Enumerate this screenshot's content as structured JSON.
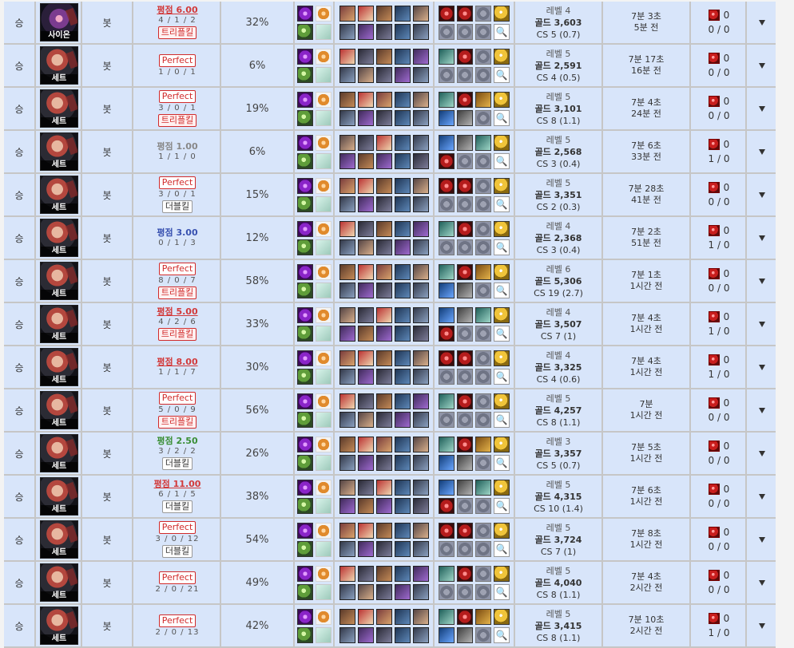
{
  "rows": [
    {
      "result": "승",
      "champion": "사이온",
      "portrait": "alt",
      "mode": "봇",
      "score_type": "score",
      "score_label": "평점 6.00",
      "score_color": "red",
      "kda": "4 / 1 / 2",
      "multikill": "트리플킬",
      "kp": "32%",
      "level": "레벨 4",
      "gold": "골드 3,603",
      "cs": "CS 5 (0.7)",
      "duration": "7분 3초",
      "ago": "5분 전",
      "ward_top": "0",
      "ward_bottom": "0 / 0"
    },
    {
      "result": "승",
      "champion": "세트",
      "portrait": "main",
      "mode": "봇",
      "score_type": "perfect",
      "score_label": "Perfect",
      "score_color": "red",
      "kda": "1 / 0 / 1",
      "multikill": "",
      "kp": "6%",
      "level": "레벨 5",
      "gold": "골드 2,591",
      "cs": "CS 4 (0.5)",
      "duration": "7분 17초",
      "ago": "16분 전",
      "ward_top": "0",
      "ward_bottom": "0 / 0"
    },
    {
      "result": "승",
      "champion": "세트",
      "portrait": "main",
      "mode": "봇",
      "score_type": "perfect",
      "score_label": "Perfect",
      "score_color": "red",
      "kda": "3 / 0 / 1",
      "multikill": "트리플킬",
      "kp": "19%",
      "level": "레벨 5",
      "gold": "골드 3,101",
      "cs": "CS 8 (1.1)",
      "duration": "7분 4초",
      "ago": "24분 전",
      "ward_top": "0",
      "ward_bottom": "0 / 0"
    },
    {
      "result": "승",
      "champion": "세트",
      "portrait": "main",
      "mode": "봇",
      "score_type": "score",
      "score_label": "평점 1.00",
      "score_color": "gray",
      "kda": "1 / 1 / 0",
      "multikill": "",
      "kp": "6%",
      "level": "레벨 5",
      "gold": "골드 2,568",
      "cs": "CS 3 (0.4)",
      "duration": "7분 6초",
      "ago": "33분 전",
      "ward_top": "0",
      "ward_bottom": "1 / 0"
    },
    {
      "result": "승",
      "champion": "세트",
      "portrait": "main",
      "mode": "봇",
      "score_type": "perfect",
      "score_label": "Perfect",
      "score_color": "red",
      "kda": "3 / 0 / 1",
      "multikill": "더블킬",
      "kp": "15%",
      "level": "레벨 5",
      "gold": "골드 3,351",
      "cs": "CS 2 (0.3)",
      "duration": "7분 28초",
      "ago": "41분 전",
      "ward_top": "0",
      "ward_bottom": "0 / 0"
    },
    {
      "result": "승",
      "champion": "세트",
      "portrait": "main",
      "mode": "봇",
      "score_type": "score",
      "score_label": "평점 3.00",
      "score_color": "blue",
      "kda": "0 / 1 / 3",
      "multikill": "",
      "kp": "12%",
      "level": "레벨 4",
      "gold": "골드 2,368",
      "cs": "CS 3 (0.4)",
      "duration": "7분 2초",
      "ago": "51분 전",
      "ward_top": "0",
      "ward_bottom": "1 / 0"
    },
    {
      "result": "승",
      "champion": "세트",
      "portrait": "main",
      "mode": "봇",
      "score_type": "perfect",
      "score_label": "Perfect",
      "score_color": "red",
      "kda": "8 / 0 / 7",
      "multikill": "트리플킬",
      "kp": "58%",
      "level": "레벨 6",
      "gold": "골드 5,306",
      "cs": "CS 19 (2.7)",
      "duration": "7분 1초",
      "ago": "1시간 전",
      "ward_top": "0",
      "ward_bottom": "0 / 0"
    },
    {
      "result": "승",
      "champion": "세트",
      "portrait": "main",
      "mode": "봇",
      "score_type": "score",
      "score_label": "평점 5.00",
      "score_color": "red",
      "kda": "4 / 2 / 6",
      "multikill": "트리플킬",
      "kp": "33%",
      "level": "레벨 4",
      "gold": "골드 3,507",
      "cs": "CS 7 (1)",
      "duration": "7분 4초",
      "ago": "1시간 전",
      "ward_top": "0",
      "ward_bottom": "1 / 0"
    },
    {
      "result": "승",
      "champion": "세트",
      "portrait": "main",
      "mode": "봇",
      "score_type": "score",
      "score_label": "평점 8.00",
      "score_color": "red",
      "kda": "1 / 1 / 7",
      "multikill": "",
      "kp": "30%",
      "level": "레벨 4",
      "gold": "골드 3,325",
      "cs": "CS 4 (0.6)",
      "duration": "7분 4초",
      "ago": "1시간 전",
      "ward_top": "0",
      "ward_bottom": "1 / 0"
    },
    {
      "result": "승",
      "champion": "세트",
      "portrait": "main",
      "mode": "봇",
      "score_type": "perfect",
      "score_label": "Perfect",
      "score_color": "red",
      "kda": "5 / 0 / 9",
      "multikill": "트리플킬",
      "kp": "56%",
      "level": "레벨 5",
      "gold": "골드 4,257",
      "cs": "CS 8 (1.1)",
      "duration": "7분",
      "ago": "1시간 전",
      "ward_top": "0",
      "ward_bottom": "0 / 0"
    },
    {
      "result": "승",
      "champion": "세트",
      "portrait": "main",
      "mode": "봇",
      "score_type": "score",
      "score_label": "평점 2.50",
      "score_color": "green",
      "kda": "3 / 2 / 2",
      "multikill": "더블킬",
      "kp": "26%",
      "level": "레벨 3",
      "gold": "골드 3,357",
      "cs": "CS 5 (0.7)",
      "duration": "7분 5초",
      "ago": "1시간 전",
      "ward_top": "0",
      "ward_bottom": "0 / 0"
    },
    {
      "result": "승",
      "champion": "세트",
      "portrait": "main",
      "mode": "봇",
      "score_type": "score",
      "score_label": "평점 11.00",
      "score_color": "red",
      "kda": "6 / 1 / 5",
      "multikill": "더블킬",
      "kp": "38%",
      "level": "레벨 5",
      "gold": "골드 4,315",
      "cs": "CS 10 (1.4)",
      "duration": "7분 6초",
      "ago": "1시간 전",
      "ward_top": "0",
      "ward_bottom": "0 / 0"
    },
    {
      "result": "승",
      "champion": "세트",
      "portrait": "main",
      "mode": "봇",
      "score_type": "perfect",
      "score_label": "Perfect",
      "score_color": "red",
      "kda": "3 / 0 / 12",
      "multikill": "더블킬",
      "kp": "54%",
      "level": "레벨 5",
      "gold": "골드 3,724",
      "cs": "CS 7 (1)",
      "duration": "7분 8초",
      "ago": "1시간 전",
      "ward_top": "0",
      "ward_bottom": "0 / 0"
    },
    {
      "result": "승",
      "champion": "세트",
      "portrait": "main",
      "mode": "봇",
      "score_type": "perfect",
      "score_label": "Perfect",
      "score_color": "red",
      "kda": "2 / 0 / 21",
      "multikill": "",
      "kp": "49%",
      "level": "레벨 5",
      "gold": "골드 4,040",
      "cs": "CS 8 (1.1)",
      "duration": "7분 4초",
      "ago": "2시간 전",
      "ward_top": "0",
      "ward_bottom": "0 / 0"
    },
    {
      "result": "승",
      "champion": "세트",
      "portrait": "main",
      "mode": "봇",
      "score_type": "perfect",
      "score_label": "Perfect",
      "score_color": "red",
      "kda": "2 / 0 / 13",
      "multikill": "",
      "kp": "42%",
      "level": "레벨 5",
      "gold": "골드 3,415",
      "cs": "CS 8 (1.1)",
      "duration": "7분 10초",
      "ago": "2시간 전",
      "ward_top": "0",
      "ward_bottom": "1 / 0"
    }
  ]
}
